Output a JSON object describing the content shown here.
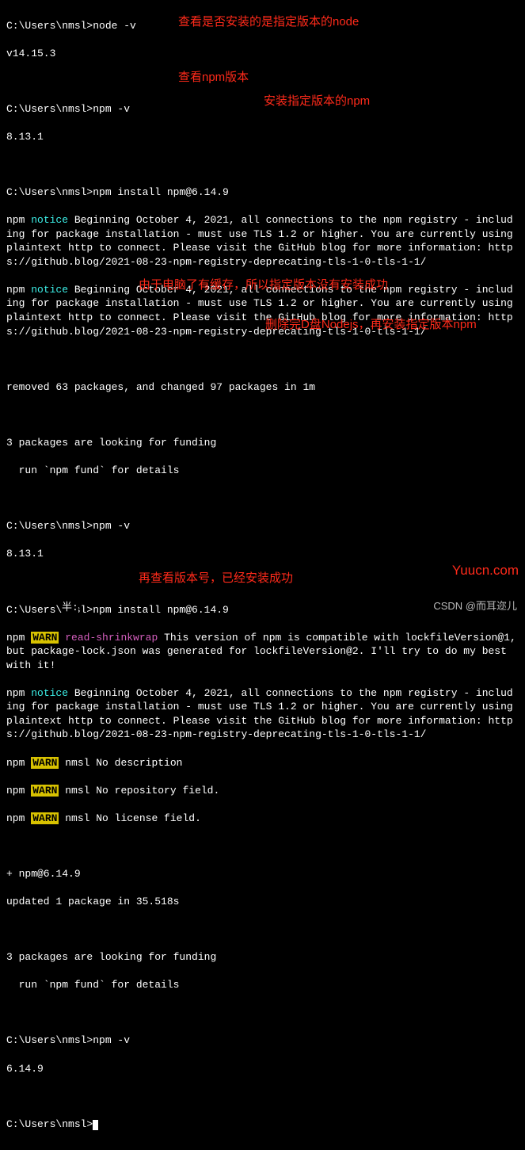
{
  "prompt_path": "C:\\Users\\nmsl>",
  "cmds": {
    "node_v": "node -v",
    "npm_v": "npm -v",
    "npm_install": "npm install npm@6.14.9"
  },
  "outputs": {
    "node_version": "v14.15.3",
    "npm_version_1": "8.13.1",
    "npm_version_2": "8.13.1",
    "npm_version_3": "6.14.9",
    "notice_prefix": "npm ",
    "notice_word": "notice",
    "notice_body": " Beginning October 4, 2021, all connections to the npm registry - including for package installation - must use TLS 1.2 or higher. You are currently using plaintext http to connect. Please visit the GitHub blog for more information: https://github.blog/2021-08-23-npm-registry-deprecating-tls-1-0-tls-1-1/",
    "removed": "removed 63 packages, and changed 97 packages in 1m",
    "funding1": "3 packages are looking for funding",
    "funding2": "  run `npm fund` for details",
    "warn_prefix": "npm ",
    "warn_word": "WARN",
    "read_shrink": " read-shrinkwrap",
    "shrink_body": " This version of npm is compatible with lockfileVersion@1, but package-lock.json was generated for lockfileVersion@2. I'll try to do my best with it!",
    "warn_desc": " nmsl No description",
    "warn_repo": " nmsl No repository field.",
    "warn_lic": " nmsl No license field.",
    "plus_pkg": "+ npm@6.14.9",
    "updated": "updated 1 package in 35.518s"
  },
  "annotations": {
    "a1": "查看是否安装的是指定版本的node",
    "a2": "查看npm版本",
    "a3": "安装指定版本的npm",
    "a4": "由于电脑了有缓存，所以指定版本没有安装成功",
    "a5": "删除完D盘Nodejs，再安装指定版本npm",
    "a6": "再查看版本号，已经安装成功"
  },
  "watermark": "Yuucn.com",
  "csdn": "CSDN @而耳迩儿",
  "ime": "半:"
}
